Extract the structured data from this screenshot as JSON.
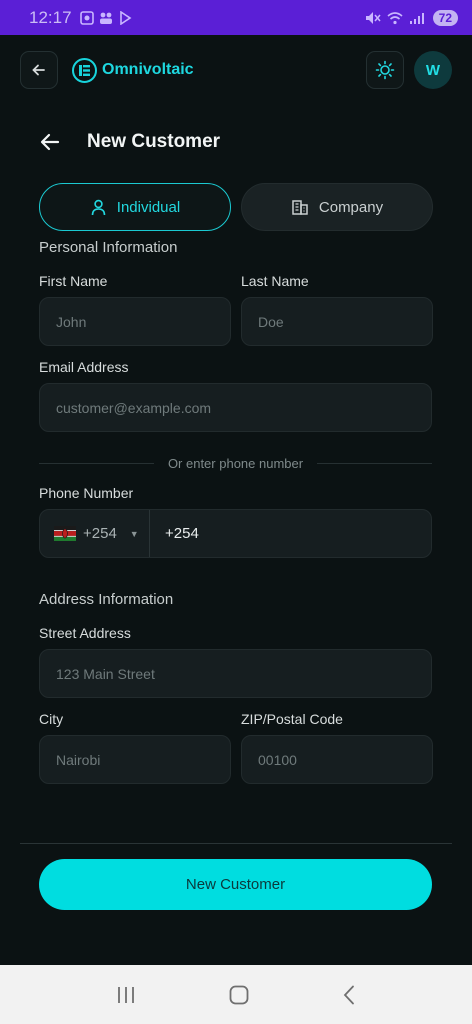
{
  "status": {
    "time": "12:17",
    "battery": "72"
  },
  "header": {
    "app_name": "Omnivoltaic",
    "avatar_initial": "W"
  },
  "page": {
    "title": "New Customer"
  },
  "customer_type": {
    "individual": "Individual",
    "company": "Company"
  },
  "personal": {
    "section_title": "Personal Information",
    "first_name_label": "First Name",
    "first_name_placeholder": "John",
    "last_name_label": "Last Name",
    "last_name_placeholder": "Doe",
    "email_label": "Email Address",
    "email_placeholder": "customer@example.com",
    "divider_text": "Or enter phone number",
    "phone_label": "Phone Number",
    "country_code": "+254",
    "phone_value": "+254"
  },
  "address": {
    "section_title": "Address Information",
    "street_label": "Street Address",
    "street_placeholder": "123 Main Street",
    "city_label": "City",
    "city_placeholder": "Nairobi",
    "zip_label": "ZIP/Postal Code",
    "zip_placeholder": "00100"
  },
  "submit_label": "New Customer",
  "colors": {
    "accent": "#00dde0",
    "status_bar": "#5b1fd6",
    "background": "#0b1213"
  },
  "icons": [
    "back-arrow-icon",
    "logo-icon",
    "sun-icon",
    "person-icon",
    "building-icon",
    "kenya-flag-icon",
    "recents-icon",
    "home-icon",
    "nav-back-icon"
  ]
}
